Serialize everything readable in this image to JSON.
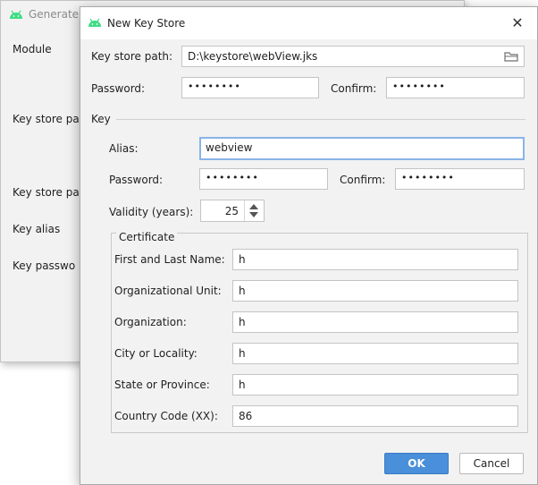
{
  "background_dialog": {
    "title": "Generate",
    "labels": [
      "Module",
      "Key store pat",
      "Key store pa",
      "Key alias",
      "Key passwo"
    ]
  },
  "dialog": {
    "title": "New Key Store",
    "close_glyph": "✕",
    "key_store_path": {
      "label": "Key store path:",
      "value": "D:\\keystore\\webView.jks"
    },
    "password": {
      "label": "Password:",
      "value": "••••••••"
    },
    "confirm": {
      "label": "Confirm:",
      "value": "••••••••"
    },
    "key_section": {
      "title": "Key",
      "alias": {
        "label": "Alias:",
        "value": "webview"
      },
      "password": {
        "label": "Password:",
        "value": "••••••••"
      },
      "confirm": {
        "label": "Confirm:",
        "value": "••••••••"
      },
      "validity": {
        "label": "Validity (years):",
        "value": "25"
      }
    },
    "certificate": {
      "title": "Certificate",
      "fields": [
        {
          "label": "First and Last Name:",
          "value": "h"
        },
        {
          "label": "Organizational Unit:",
          "value": "h"
        },
        {
          "label": "Organization:",
          "value": "h"
        },
        {
          "label": "City or Locality:",
          "value": "h"
        },
        {
          "label": "State or Province:",
          "value": "h"
        },
        {
          "label": "Country Code (XX):",
          "value": "86"
        }
      ]
    },
    "buttons": {
      "ok": "OK",
      "cancel": "Cancel"
    }
  },
  "colors": {
    "accent": "#4a8fd9",
    "focus_border": "#8ab4e8",
    "android_green": "#3ddc84"
  }
}
